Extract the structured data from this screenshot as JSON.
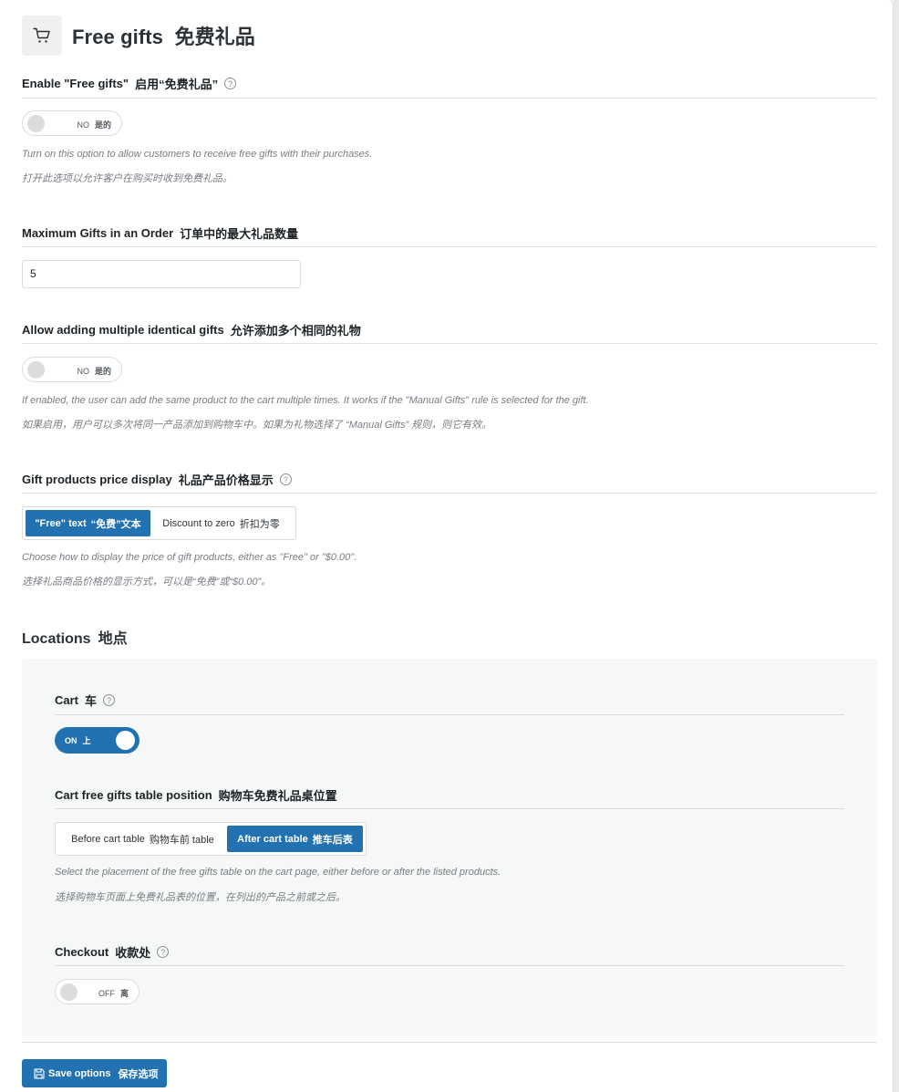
{
  "header": {
    "title_en": "Free gifts",
    "title_zh": "免费礼品",
    "icon": "cart-icon"
  },
  "enable": {
    "label_en": "Enable \"Free gifts\"",
    "label_zh": "启用“免费礼品”",
    "toggle_en": "NO",
    "toggle_zh": "是的",
    "desc_en": "Turn on this option to allow customers to receive free gifts with their purchases.",
    "desc_zh": "打开此选项以允许客户在购买时收到免费礼品。"
  },
  "max_gifts": {
    "label_en": "Maximum Gifts in an Order",
    "label_zh": "订单中的最大礼品数量",
    "value": "5"
  },
  "identical": {
    "label_en": "Allow adding multiple identical gifts",
    "label_zh": "允许添加多个相同的礼物",
    "toggle_en": "NO",
    "toggle_zh": "是的",
    "desc_en": "If enabled, the user can add the same product to the cart multiple times. It works if the \"Manual Gifts\" rule is selected for the gift.",
    "desc_zh": "如果启用，用户可以多次将同一产品添加到购物车中。如果为礼物选择了 “Manual Gifts” 规则，则它有效。"
  },
  "price_display": {
    "label_en": "Gift products price display",
    "label_zh": "礼品产品价格显示",
    "options": [
      {
        "en": "\"Free\" text",
        "zh": "“免费”文本",
        "active": true
      },
      {
        "en": "Discount to zero",
        "zh": "折扣为零",
        "active": false
      }
    ],
    "desc_en": "Choose how to display the price of gift products, either as \"Free\" or \"$0.00\".",
    "desc_zh": "选择礼品商品价格的显示方式，可以是“免费”或“$0.00”。"
  },
  "locations": {
    "title_en": "Locations",
    "title_zh": "地点",
    "cart": {
      "label_en": "Cart",
      "label_zh": "车",
      "toggle_en": "ON",
      "toggle_zh": "上"
    },
    "table_position": {
      "label_en": "Cart free gifts table position",
      "label_zh": "购物车免费礼品桌位置",
      "options": [
        {
          "en": "Before cart table",
          "zh": "购物车前 table",
          "active": false
        },
        {
          "en": "After cart table",
          "zh": "推车后表",
          "active": true
        }
      ],
      "desc_en": "Select the placement of the free gifts table on the cart page, either before or after the listed products.",
      "desc_zh": "选择购物车页面上免费礼品表的位置，在列出的产品之前或之后。"
    },
    "checkout": {
      "label_en": "Checkout",
      "label_zh": "收款处",
      "toggle_en": "OFF",
      "toggle_zh": "离"
    }
  },
  "save": {
    "label_en": "Save options",
    "label_zh": "保存选项"
  },
  "colors": {
    "accent": "#2271b1",
    "panel_bg": "#ffffff",
    "locations_bg": "#f6f7f7"
  }
}
